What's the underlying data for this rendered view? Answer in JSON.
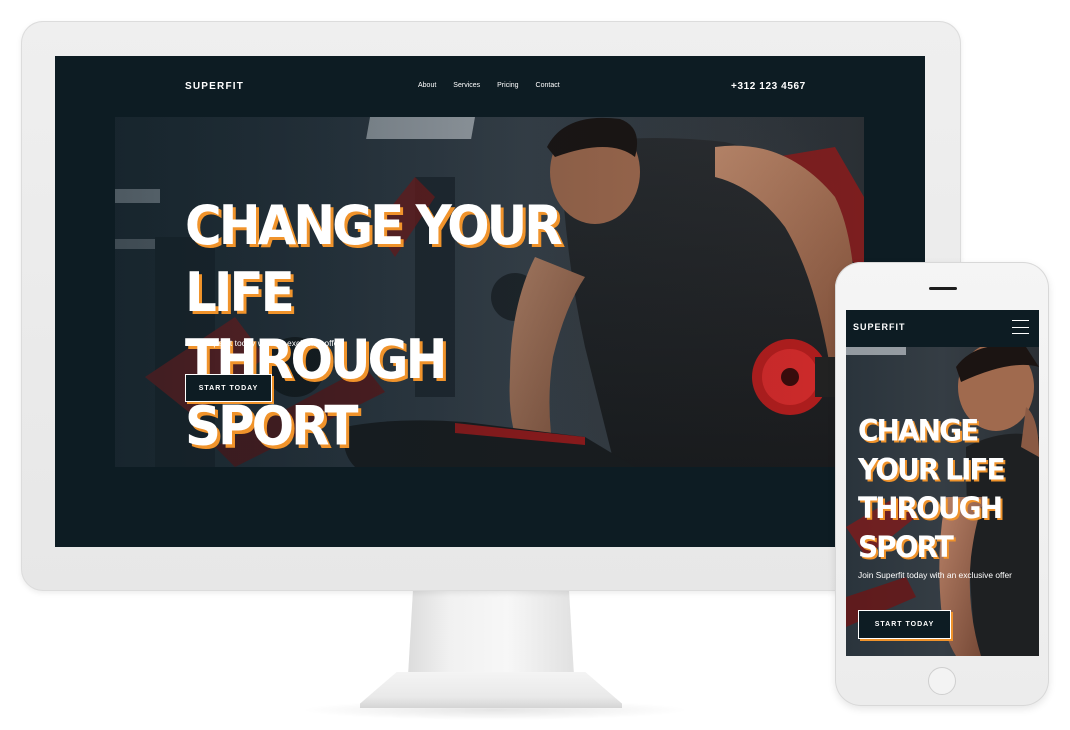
{
  "brand": {
    "accent": "#f0932b",
    "background": "#0d1c23",
    "text": "#ffffff"
  },
  "desktop": {
    "logo": "SUPERFIT",
    "nav": [
      "About",
      "Services",
      "Pricing",
      "Contact"
    ],
    "phone": "+312 123 4567",
    "hero": {
      "headline_line1": "CHANGE YOUR LIFE",
      "headline_line2": "THROUGH SPORT",
      "subtitle": "Join Superfit today with an exclusive offer",
      "cta": "START TODAY"
    }
  },
  "mobile": {
    "logo": "SUPERFIT",
    "menu_icon": "hamburger-menu-icon",
    "hero": {
      "headline_lines": [
        "CHANGE",
        "YOUR LIFE",
        "THROUGH",
        "SPORT"
      ],
      "subtitle": "Join Superfit today with an exclusive offer",
      "cta": "START TODAY"
    }
  }
}
